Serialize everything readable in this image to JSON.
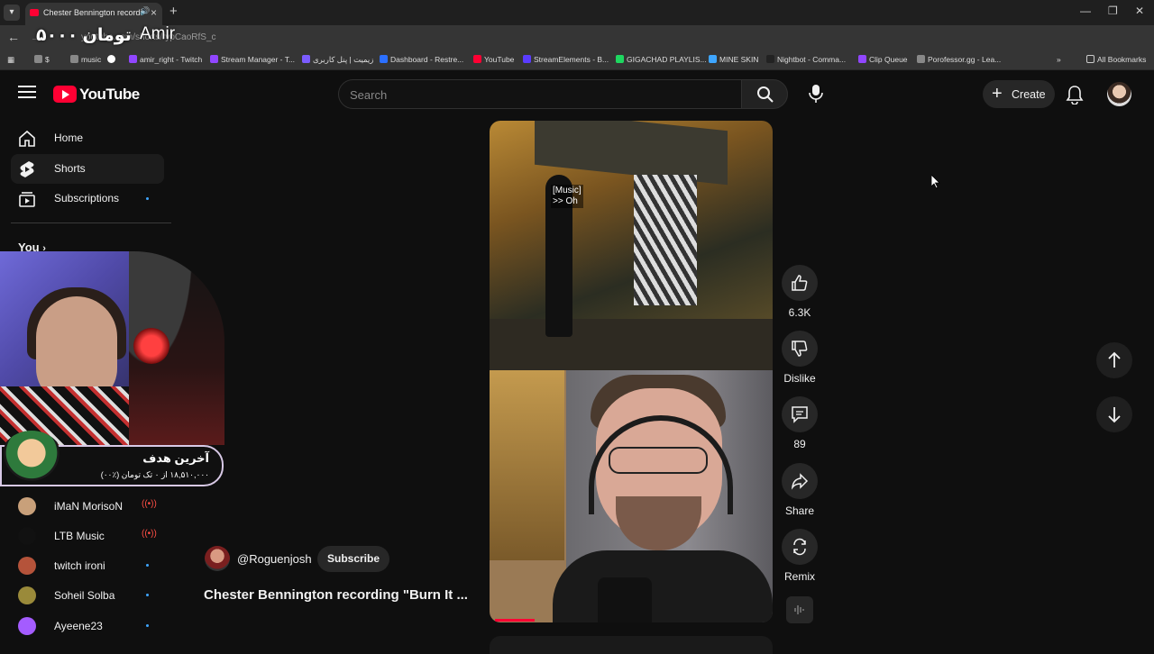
{
  "browser": {
    "tab_title": "Chester Bennington recording",
    "url": "youtube.com/shorts/rypCaoRfS_c",
    "overlay_text": "۵۰۰۰ تومان",
    "overlay_name": "Amir",
    "bookmarks": [
      {
        "label": "$",
        "color": "#888888"
      },
      {
        "label": "music",
        "color": "#888888"
      },
      {
        "label": "",
        "color": "#ffffff"
      },
      {
        "label": "amir_right - Twitch",
        "color": "#9146ff"
      },
      {
        "label": "Stream Manager - T...",
        "color": "#9146ff"
      },
      {
        "label": "زیمیت | پنل کاربری",
        "color": "#7b5cff"
      },
      {
        "label": "Dashboard - Restre...",
        "color": "#2b6fff"
      },
      {
        "label": "YouTube",
        "color": "#ff0033"
      },
      {
        "label": "StreamElements - B...",
        "color": "#5a3cff"
      },
      {
        "label": "GIGACHAD PLAYLIS...",
        "color": "#1ed760"
      },
      {
        "label": "MINE SKIN",
        "color": "#3ea6ff"
      },
      {
        "label": "Nightbot - Comma...",
        "color": "#222222"
      },
      {
        "label": "Clip Queue",
        "color": "#9146ff"
      },
      {
        "label": "Porofessor.gg - Lea...",
        "color": "#888888"
      }
    ],
    "all_bookmarks": "All Bookmarks"
  },
  "header": {
    "logo_text": "YouTube",
    "search_placeholder": "Search",
    "create_label": "Create"
  },
  "sidebar": {
    "home": "Home",
    "shorts": "Shorts",
    "subscriptions": "Subscriptions",
    "you": "You",
    "subs": [
      {
        "name": "iMaN MorisoN",
        "live": true,
        "color": "#c8a07a"
      },
      {
        "name": "LTB Music",
        "live": true,
        "color": "#111111"
      },
      {
        "name": "twitch ironi",
        "live": false,
        "color": "#b5533a"
      },
      {
        "name": "Soheil Solba",
        "live": false,
        "color": "#9a8a3a"
      },
      {
        "name": "Ayeene23",
        "live": false,
        "color": "#a45cff"
      }
    ]
  },
  "goal": {
    "title": "آخرین هدف",
    "subtitle": "۱۸,۵۱۰,۰۰۰ از ۰ تک تومان (٪۰۰)"
  },
  "short": {
    "caption_line1": "[Music]",
    "caption_line2": ">> Oh",
    "channel": "@Roguenjosh",
    "subscribe": "Subscribe",
    "title": "Chester Bennington recording \"Burn It ...",
    "progress_fraction": 0.14
  },
  "actions": {
    "likes": "6.3K",
    "dislike": "Dislike",
    "comments": "89",
    "share": "Share",
    "remix": "Remix"
  }
}
